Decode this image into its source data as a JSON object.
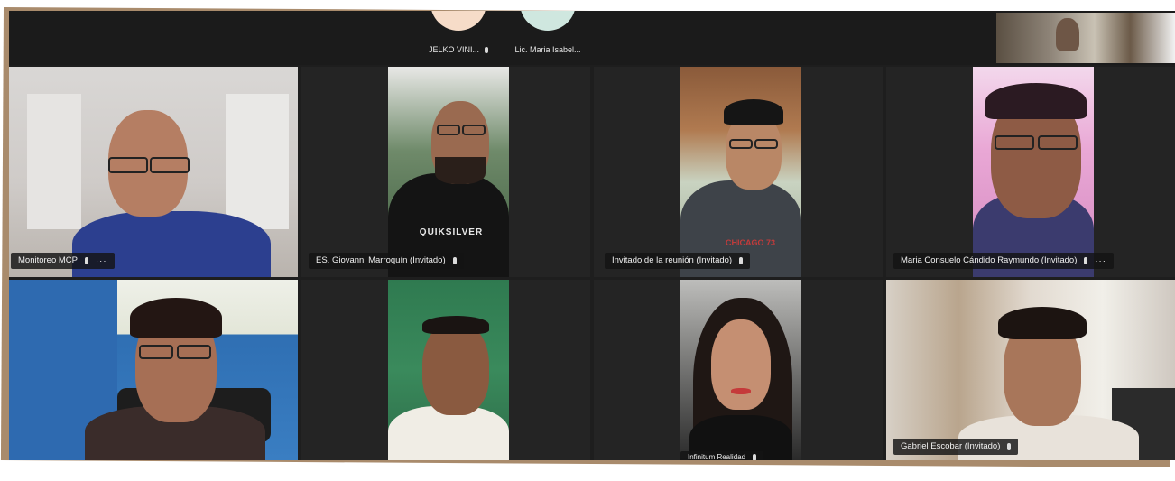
{
  "meeting": {
    "top_row": [
      {
        "name": "JELKO VINI...",
        "avatar_color": "#f6dcc8"
      },
      {
        "name": "Lic. Maria Isabel...",
        "avatar_color": "#cfe7df"
      }
    ],
    "participants": [
      {
        "name": "Monitoreo MCP",
        "more": "···"
      },
      {
        "name": "ES. Giovanni Marroquín (Invitado)"
      },
      {
        "name": "Invitado de la reunión (Invitado)"
      },
      {
        "name": "Maria Consuelo Cándido Raymundo (Invitado)",
        "more": "···"
      },
      {
        "name": "",
        "more": ""
      },
      {
        "name": ""
      },
      {
        "name": "Infinitum Realidad"
      },
      {
        "name": "Gabriel Escobar (Invitado)"
      }
    ],
    "shirt_text": "QUIKSILVER",
    "shirt_text_2": "CHICAGO 73"
  },
  "colors": {
    "frame": "#a98b6c",
    "background": "#1e1e1e",
    "tile_bg": "#242424"
  }
}
